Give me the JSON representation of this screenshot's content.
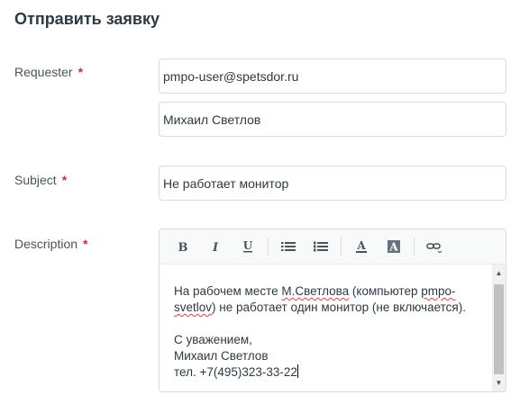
{
  "page": {
    "title": "Отправить заявку"
  },
  "form": {
    "requester": {
      "label": "Requester",
      "required_mark": "*",
      "email_value": "pmpo-user@spetsdor.ru",
      "name_value": "Михаил Светлов"
    },
    "subject": {
      "label": "Subject",
      "required_mark": "*",
      "value": "Не работает монитор"
    },
    "description": {
      "label": "Description",
      "required_mark": "*",
      "toolbar": [
        {
          "name": "bold-button",
          "icon": "bold-icon"
        },
        {
          "name": "italic-button",
          "icon": "italic-icon"
        },
        {
          "name": "underline-button",
          "icon": "underline-icon"
        },
        {
          "name": "bulleted-list-button",
          "icon": "bulleted-list-icon"
        },
        {
          "name": "numbered-list-button",
          "icon": "numbered-list-icon"
        },
        {
          "name": "text-color-button",
          "icon": "text-color-icon"
        },
        {
          "name": "background-color-button",
          "icon": "background-color-icon"
        },
        {
          "name": "insert-link-button",
          "icon": "link-icon"
        }
      ],
      "content": {
        "line1_a": "На рабочем месте ",
        "line1_b": "М.Светлова",
        "line1_c": " (компьютер ",
        "line1_d": "pmpo-",
        "line2_a": "svetlov",
        "line2_b": ") не работает один монитор (не включается).",
        "signature_1": "С уважением,",
        "signature_2": "Михаил Светлов",
        "signature_3": "тел. +7(495)323-33-22"
      }
    }
  },
  "colors": {
    "required": "#cc3340",
    "spellcheck": "#d93f4c",
    "border": "#d8dcde"
  }
}
